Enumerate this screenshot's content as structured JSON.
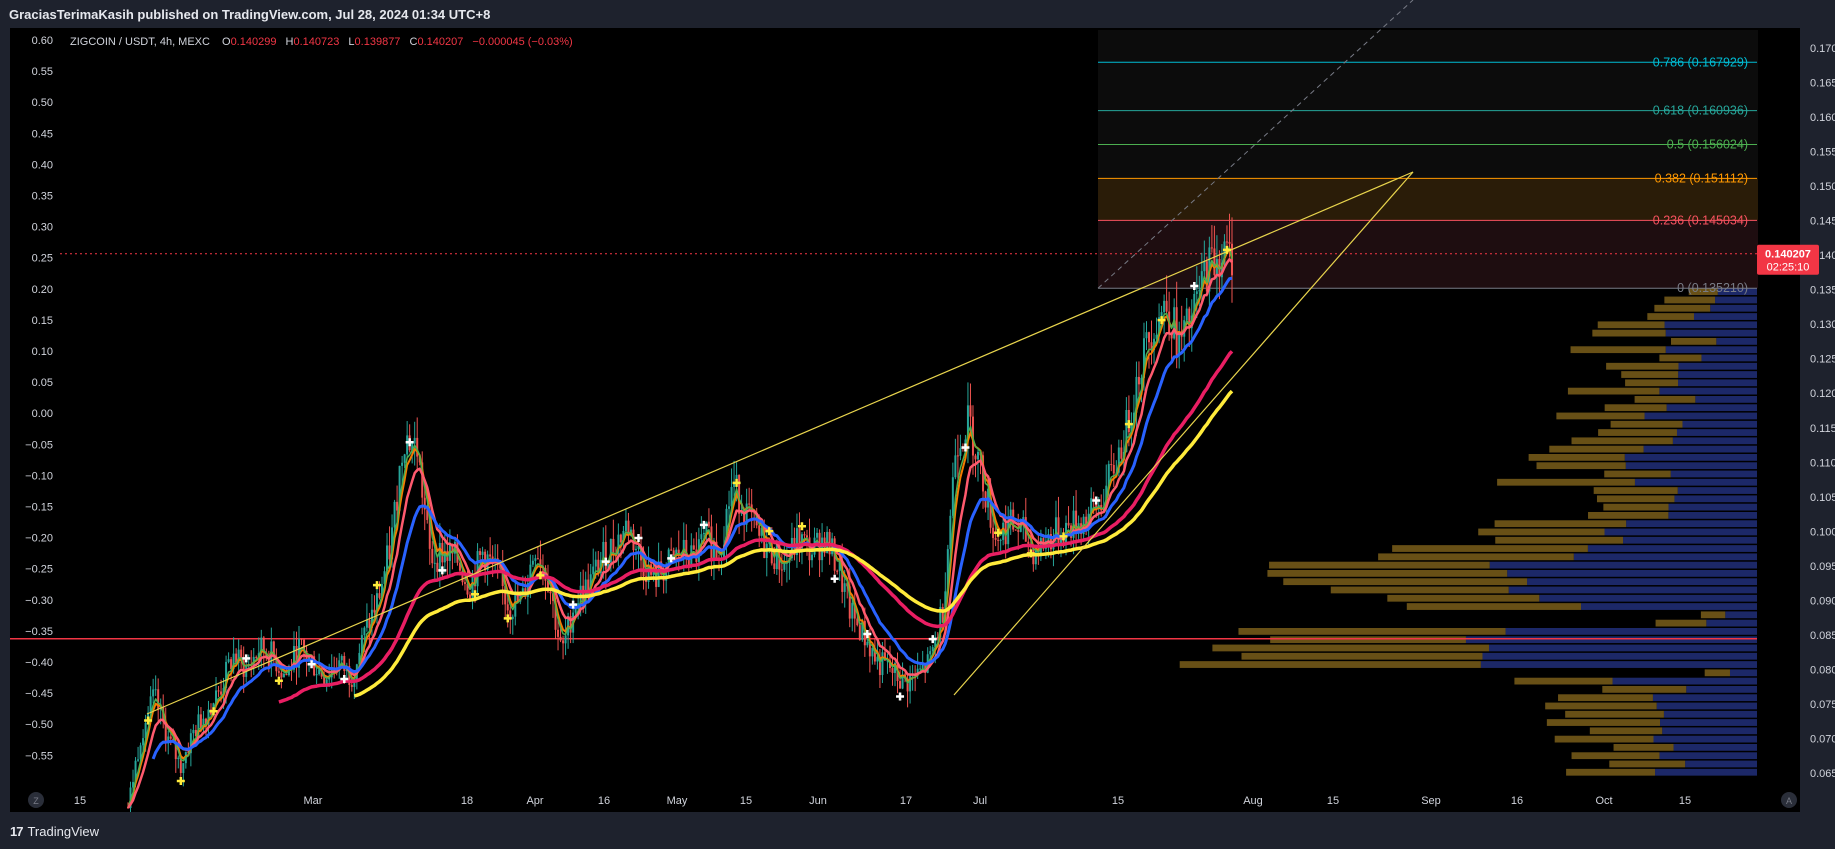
{
  "header": {
    "published": "GraciasTerimaKasih published on TradingView.com, Jul 28, 2024 01:34 UTC+8"
  },
  "legend": {
    "symbol": "ZIGCOIN / USDT, 4h, MEXC",
    "o_label": "O",
    "o_value": "0.140299",
    "h_label": "H",
    "h_value": "0.140723",
    "l_label": "L",
    "l_value": "0.139877",
    "c_label": "C",
    "c_value": "0.140207",
    "change": "−0.000045 (−0.03%)"
  },
  "footer": {
    "brand": "TradingView",
    "logo_glyph": "17",
    "btn_left": "Z",
    "btn_right": "A"
  },
  "colors": {
    "bg": "#000000",
    "frame": "#1e222d",
    "up": "#26a69a",
    "down": "#ef5350",
    "ma_fast": "#2962ff",
    "ma_mid": "#e91e63",
    "ma_slow": "#ffeb3b",
    "vp_up": "#1e2a6e",
    "vp_down": "#6e5417",
    "support": "#f23645",
    "trend": "#e8d44d"
  },
  "chart_data": {
    "type": "candlestick",
    "symbol": "ZIGCOIN / USDT",
    "timeframe": "4h",
    "exchange": "MEXC",
    "last_price": "0.140207",
    "countdown": "02:25:10",
    "x_ticks": [
      "15",
      "Mar",
      "18",
      "Apr",
      "16",
      "May",
      "15",
      "Jun",
      "17",
      "Jul",
      "15",
      "Aug",
      "15",
      "Sep",
      "16",
      "Oct",
      "15"
    ],
    "left_axis_ticks": [
      "0.60",
      "0.55",
      "0.50",
      "0.45",
      "0.40",
      "0.35",
      "0.30",
      "0.25",
      "0.20",
      "0.15",
      "0.10",
      "0.05",
      "0.00",
      "−0.05",
      "−0.10",
      "−0.15",
      "−0.20",
      "−0.25",
      "−0.30",
      "−0.35",
      "−0.40",
      "−0.45",
      "−0.50",
      "−0.55"
    ],
    "right_axis_ticks": [
      "0.170000",
      "0.165000",
      "0.160000",
      "0.155000",
      "0.150000",
      "0.145000",
      "0.140000",
      "0.135000",
      "0.130000",
      "0.125000",
      "0.120000",
      "0.115000",
      "0.110000",
      "0.105000",
      "0.100000",
      "0.095000",
      "0.090000",
      "0.085000",
      "0.080000",
      "0.075000",
      "0.070000",
      "0.065000"
    ],
    "ylim": [
      0.0625,
      0.1728
    ],
    "fib_levels": [
      {
        "label": "0.786 (0.167929)",
        "value": 0.167929,
        "color": "#00bcd4"
      },
      {
        "label": "0.618 (0.160936)",
        "value": 0.160936,
        "color": "#26a69a"
      },
      {
        "label": "0.5 (0.156024)",
        "value": 0.156024,
        "color": "#4caf50"
      },
      {
        "label": "0.382 (0.151112)",
        "value": 0.151112,
        "color": "#ff9800"
      },
      {
        "label": "0.236 (0.145034)",
        "value": 0.145034,
        "color": "#f7525f"
      },
      {
        "label": "0 (0.135210)",
        "value": 0.13521,
        "color": "#787b86"
      }
    ],
    "support_level": 0.08445,
    "price_path": [
      [
        0.06,
        0.071,
        0.076,
        0.07,
        0.066,
        0.071,
        0.074,
        0.077,
        0.082,
        0.08,
        0.083,
        0.082,
        0.079,
        0.083,
        0.081,
        0.079,
        0.081,
        0.079,
        0.085,
        0.09,
        0.098,
        0.114,
        0.112,
        0.096,
        0.097,
        0.096,
        0.092,
        0.097,
        0.094,
        0.089,
        0.09,
        0.098,
        0.093,
        0.082,
        0.09,
        0.092,
        0.096,
        0.098,
        0.101,
        0.096,
        0.093,
        0.095,
        0.097,
        0.096,
        0.099,
        0.097,
        0.107,
        0.103,
        0.099,
        0.097,
        0.095,
        0.099,
        0.097,
        0.099,
        0.095,
        0.088,
        0.085,
        0.081,
        0.08,
        0.078,
        0.079,
        0.081,
        0.089,
        0.113,
        0.116,
        0.108,
        0.099,
        0.101,
        0.1,
        0.097,
        0.099,
        0.1,
        0.101,
        0.102,
        0.104,
        0.109,
        0.115,
        0.124,
        0.13,
        0.133,
        0.127,
        0.131,
        0.138,
        0.14,
        0.14
      ]
    ]
  }
}
